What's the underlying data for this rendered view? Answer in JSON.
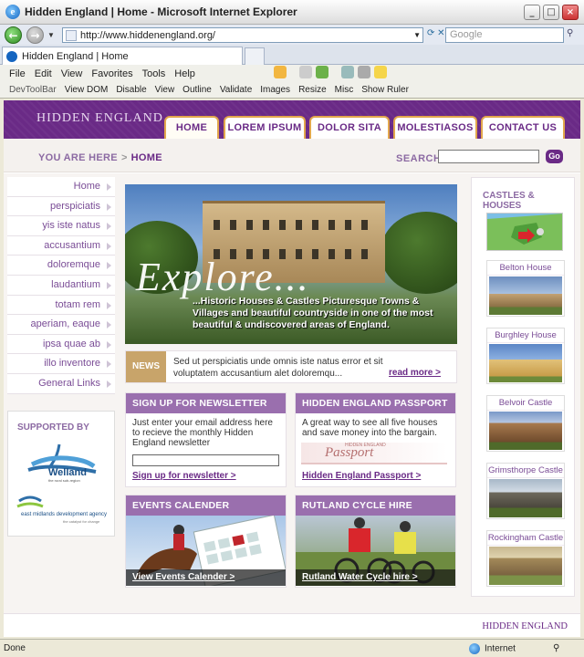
{
  "window": {
    "title": "Hidden England | Home - Microsoft Internet Explorer"
  },
  "browser": {
    "address": "http://www.hiddenengland.org/",
    "search_placeholder": "Google",
    "tab_title": "Hidden England | Home",
    "menu": [
      "File",
      "Edit",
      "View",
      "Favorites",
      "Tools",
      "Help"
    ],
    "devtoolbar": [
      "DevToolBar",
      "View DOM",
      "Disable",
      "View",
      "Outline",
      "Validate",
      "Images",
      "Resize",
      "Misc",
      "Show Ruler"
    ]
  },
  "site": {
    "logo": "HIDDEN ENGLAND",
    "nav": [
      "HOME",
      "LOREM IPSUM",
      "DOLOR SITA",
      "MOLESTIASOS",
      "CONTACT US"
    ],
    "breadcrumb": {
      "prefix": "YOU ARE HERE",
      "current": "HOME"
    },
    "search_label": "SEARCH",
    "search_button": "Go"
  },
  "sidebar": {
    "items": [
      "Home",
      "perspiciatis",
      "yis iste natus",
      "accusantium",
      "doloremque",
      "laudantium",
      "totam rem",
      "aperiam, eaque",
      "ipsa quae ab",
      "illo inventore",
      "General Links"
    ],
    "supported_label": "SUPPORTED BY",
    "welland": "Welland",
    "welland_sub": "the rural sub-region",
    "emda": "east midlands development agency",
    "emda_sub": "the catalyst for change"
  },
  "hero": {
    "headline": "Explore...",
    "text": "...Historic Houses & Castles Picturesque Towns & Villages and beautiful countryside in one of the most beautiful & undiscovered areas of England."
  },
  "news": {
    "tag": "NEWS",
    "text": "Sed ut perspiciatis unde omnis iste natus error et sit voluptatem accusantium alet doloremqu...",
    "more": "read more >"
  },
  "boxes": {
    "newsletter": {
      "title": "SIGN UP FOR NEWSLETTER",
      "text": "Just enter your email address here to recieve the monthly Hidden England newsletter",
      "link": "Sign up for newsletter >"
    },
    "passport": {
      "title": "HIDDEN ENGLAND PASSPORT",
      "text": "A great way to see all five houses and save money into the bargain.",
      "logo_small": "HIDDEN ENGLAND",
      "logo": "Passport",
      "link": "Hidden England Passport >"
    },
    "events": {
      "title": "EVENTS CALENDER",
      "link": "View Events Calender >"
    },
    "cycle": {
      "title": "RUTLAND CYCLE HIRE",
      "link": "Rutland Water Cycle hire >"
    }
  },
  "castles": {
    "label": "CASTLES & HOUSES",
    "items": [
      "Belton House",
      "Burghley House",
      "Belvoir Castle",
      "Grimsthorpe Castle",
      "Rockingham Castle"
    ]
  },
  "footer": {
    "logo": "HIDDEN ENGLAND"
  },
  "status": {
    "text": "Done",
    "zone": "Internet"
  }
}
